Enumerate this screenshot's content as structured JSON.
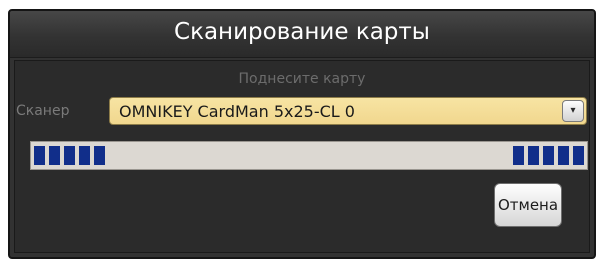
{
  "dialog": {
    "title": "Сканирование карты",
    "hint": "Поднесите карту",
    "scanner_label": "Сканер",
    "scanner_value": "OMNIKEY CardMan 5x25-CL 0",
    "dropdown_glyph": "▾",
    "cancel_label": "Отмена"
  },
  "progress": {
    "state": "indeterminate",
    "left_segments": 5,
    "right_segments": 5
  },
  "colors": {
    "dialog_background": "#323232",
    "select_background": "#f1d78e",
    "progress_segment": "#112e8a",
    "progress_track": "#dcd8d2"
  }
}
